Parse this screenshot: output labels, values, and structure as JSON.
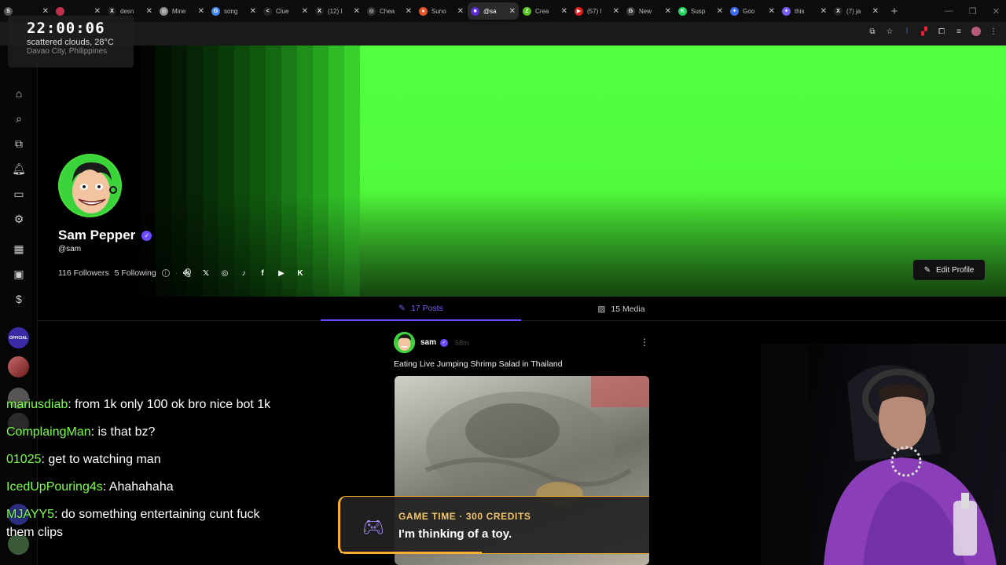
{
  "browser": {
    "tabs": [
      {
        "title": "",
        "color": "#555555",
        "glyph": "S"
      },
      {
        "title": "",
        "color": "#c0304a",
        "glyph": ""
      },
      {
        "title": "desn",
        "color": "#222222",
        "glyph": "X"
      },
      {
        "title": "Mine",
        "color": "#888888",
        "glyph": "◎"
      },
      {
        "title": "song",
        "color": "#4285f4",
        "glyph": "G"
      },
      {
        "title": "Clue",
        "color": "#222222",
        "glyph": "<"
      },
      {
        "title": "(12) I",
        "color": "#222222",
        "glyph": "X"
      },
      {
        "title": "Chea",
        "color": "#2f2f2f",
        "glyph": "◎"
      },
      {
        "title": "Suno",
        "color": "#e8542a",
        "glyph": "●"
      },
      {
        "title": "@sa",
        "color": "#5b2bd8",
        "glyph": "■"
      },
      {
        "title": "Crea",
        "color": "#55c21b",
        "glyph": "Z"
      },
      {
        "title": "(57) I",
        "color": "#e21b1b",
        "glyph": "▶"
      },
      {
        "title": "New",
        "color": "#3a3a3a",
        "glyph": "G"
      },
      {
        "title": "Susp",
        "color": "#1bd65a",
        "glyph": "K"
      },
      {
        "title": "Goo",
        "color": "#3f6cf0",
        "glyph": "✦"
      },
      {
        "title": "this",
        "color": "#7a5af5",
        "glyph": "✦"
      },
      {
        "title": "(7) ja",
        "color": "#222222",
        "glyph": "X"
      }
    ],
    "active_tab_index": 9,
    "close_glyph": "✕",
    "new_tab_glyph": "+"
  },
  "clock": {
    "time": "22:00:06",
    "weather": "scattered clouds, 28°C",
    "location": "Davao City, Philippines"
  },
  "profile": {
    "name": "Sam Pepper",
    "handle": "@sam",
    "followers": "116 Followers",
    "following": "5 Following",
    "edit_label": "Edit Profile",
    "socials": [
      "snapchat-icon",
      "x-icon",
      "instagram-icon",
      "tiktok-icon",
      "facebook-icon",
      "youtube-icon",
      "kick-icon"
    ],
    "banner_color": "#53ff3e"
  },
  "tabs": {
    "posts": "17 Posts",
    "media": "15 Media"
  },
  "post": {
    "user": "sam",
    "time": "58m",
    "title": "Eating Live Jumping Shrimp Salad in Thailand"
  },
  "chat": [
    {
      "user": "mariusdiab",
      "message": "from 1k only 100 ok bro nice bot 1k"
    },
    {
      "user": "ComplaingMan",
      "message": "is that bz?"
    },
    {
      "user": "01025",
      "message": "get to watching man"
    },
    {
      "user": "IcedUpPouring4s",
      "message": "Ahahahaha"
    },
    {
      "user": "MJAYY5",
      "message": "do something entertaining cunt fuck them clips"
    }
  ],
  "game_alert": {
    "title": "GAME TIME · 300 CREDITS",
    "text": "I'm thinking of a toy."
  },
  "rail": {
    "official_label": "OFFICIAL"
  }
}
